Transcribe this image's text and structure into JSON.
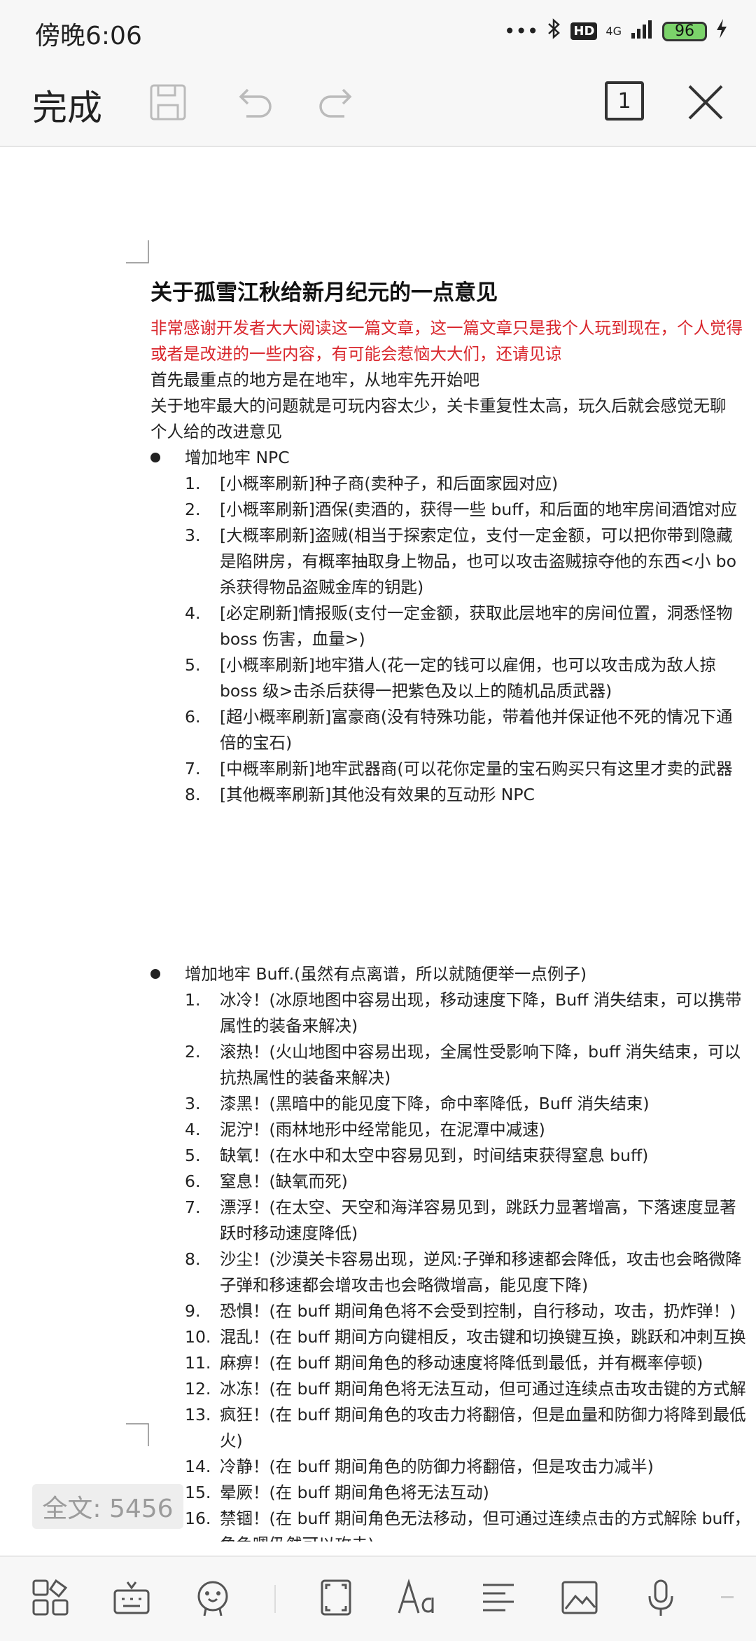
{
  "status_bar": {
    "time": "傍晚6:06",
    "network": "4G",
    "hd_badge": "HD",
    "battery_level": "96"
  },
  "toolbar": {
    "done_label": "完成",
    "page_count": "1",
    "icons": [
      "save-icon",
      "undo-icon",
      "redo-icon",
      "page-count",
      "close-icon"
    ]
  },
  "document": {
    "title": "关于孤雪江秋给新月纪元的一点意见",
    "intro_red": [
      "非常感谢开发者大大阅读这一篇文章，这一篇文章只是我个人玩到现在，个人觉得",
      "或者是改进的一些内容，有可能会惹恼大大们，还请见谅"
    ],
    "intro": [
      "首先最重点的地方是在地牢，从地牢先开始吧",
      "关于地牢最大的问题就是可玩内容太少，关卡重复性太高，玩久后就会感觉无聊",
      "个人给的改进意见"
    ],
    "section1": {
      "heading": "增加地牢 NPC",
      "items": [
        {
          "num": "1.",
          "lines": [
            "[小概率刷新]种子商(卖种子，和后面家园对应)"
          ]
        },
        {
          "num": "2.",
          "lines": [
            "[小概率刷新]酒保(卖酒的，获得一些 buff，和后面的地牢房间酒馆对应"
          ]
        },
        {
          "num": "3.",
          "lines": [
            "[大概率刷新]盗贼(相当于探索定位，支付一定金额，可以把你带到隐藏",
            "是陷阱房，有概率抽取身上物品，也可以攻击盗贼掠夺他的东西<小 bo",
            "杀获得物品盗贼金库的钥匙)"
          ]
        },
        {
          "num": "4.",
          "lines": [
            "[必定刷新]情报贩(支付一定金额，获取此层地牢的房间位置，洞悉怪物",
            "boss 伤害，血量>)"
          ]
        },
        {
          "num": "5.",
          "lines": [
            "[小概率刷新]地牢猎人(花一定的钱可以雇佣，也可以攻击成为敌人掠",
            "boss 级>击杀后获得一把紫色及以上的随机品质武器)"
          ]
        },
        {
          "num": "6.",
          "lines": [
            "[超小概率刷新]富豪商(没有特殊功能，带着他并保证他不死的情况下通",
            "倍的宝石)"
          ]
        },
        {
          "num": "7.",
          "lines": [
            "[中概率刷新]地牢武器商(可以花你定量的宝石购买只有这里才卖的武器"
          ]
        },
        {
          "num": "8.",
          "lines": [
            "[其他概率刷新]其他没有效果的互动形 NPC"
          ]
        }
      ]
    },
    "section2": {
      "heading": "增加地牢 Buff.(虽然有点离谱，所以就随便举一点例子)",
      "items": [
        {
          "num": "1.",
          "lines": [
            "冰冷！(冰原地图中容易出现，移动速度下降，Buff 消失结束，可以携带",
            "属性的装备来解决)"
          ]
        },
        {
          "num": "2.",
          "lines": [
            "滚热！(火山地图中容易出现，全属性受影响下降，buff 消失结束，可以",
            "抗热属性的装备来解决)"
          ]
        },
        {
          "num": "3.",
          "lines": [
            "漆黑！(黑暗中的能见度下降，命中率降低，Buff 消失结束)"
          ]
        },
        {
          "num": "4.",
          "lines": [
            "泥泞！(雨林地形中经常能见，在泥潭中减速)"
          ]
        },
        {
          "num": "5.",
          "lines": [
            "缺氧！(在水中和太空中容易见到，时间结束获得窒息 buff)"
          ]
        },
        {
          "num": "6.",
          "lines": [
            "窒息！(缺氧而死)"
          ]
        },
        {
          "num": "7.",
          "lines": [
            "漂浮！(在太空、天空和海洋容易见到，跳跃力显著增高，下落速度显著",
            "跃时移动速度降低)"
          ]
        },
        {
          "num": "8.",
          "lines": [
            "沙尘！(沙漠关卡容易出现，逆风:子弹和移速都会降低，攻击也会略微降",
            "子弹和移速都会增攻击也会略微增高，能见度下降)"
          ]
        },
        {
          "num": "9.",
          "lines": [
            "恐惧！(在 buff 期间角色将不会受到控制，自行移动，攻击，扔炸弹！)"
          ]
        },
        {
          "num": "10.",
          "lines": [
            "混乱！(在 buff 期间方向键相反，攻击键和切换键互换，跳跃和冲刺互换"
          ]
        },
        {
          "num": "11.",
          "lines": [
            "麻痹！(在 buff 期间角色的移动速度将降低到最低，并有概率停顿)"
          ]
        },
        {
          "num": "12.",
          "lines": [
            "冰冻！(在 buff 期间角色将无法互动，但可通过连续点击攻击键的方式解"
          ]
        },
        {
          "num": "13.",
          "lines": [
            "疯狂！(在 buff 期间角色的攻击力将翻倍，但是血量和防御力将降到最低",
            "火)"
          ]
        },
        {
          "num": "14.",
          "lines": [
            "冷静！(在 buff 期间角色的防御力将翻倍，但是攻击力减半)"
          ]
        },
        {
          "num": "15.",
          "lines": [
            "晕厥！(在 buff 期间角色将无法互动)"
          ]
        },
        {
          "num": "16.",
          "lines": [
            "禁锢！(在 buff 期间角色无法移动，但可通过连续点击的方式解除 buff，",
            "角色嗯仍然可以攻击)"
          ]
        }
      ]
    }
  },
  "word_count": "全文: 5456",
  "bottom_bar": {
    "icons": [
      "grid-apps-icon",
      "keyboard-icon",
      "stamp-icon",
      "fullscreen-icon",
      "text-format-icon",
      "align-icon",
      "image-icon",
      "microphone-icon"
    ]
  },
  "colors": {
    "accent_red": "#d9262c",
    "bar_bg": "#f7f7f7",
    "battery_green": "#7bd36a"
  }
}
